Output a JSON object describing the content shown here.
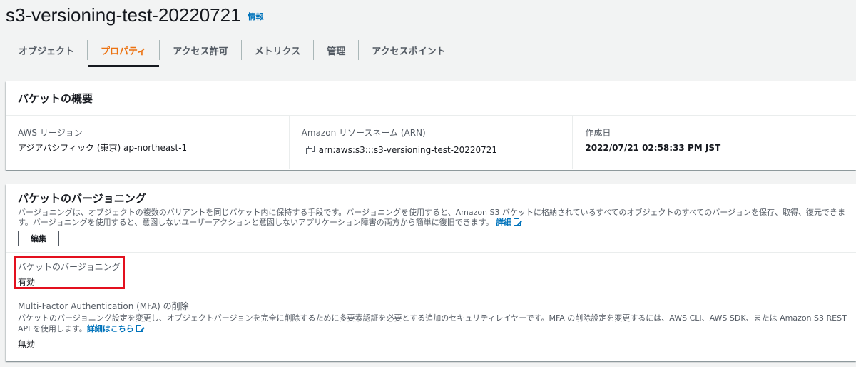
{
  "header": {
    "title": "s3-versioning-test-20220721",
    "info_link": "情報"
  },
  "tabs": [
    {
      "label": "オブジェクト",
      "active": false
    },
    {
      "label": "プロパティ",
      "active": true
    },
    {
      "label": "アクセス許可",
      "active": false
    },
    {
      "label": "メトリクス",
      "active": false
    },
    {
      "label": "管理",
      "active": false
    },
    {
      "label": "アクセスポイント",
      "active": false
    }
  ],
  "overview": {
    "heading": "バケットの概要",
    "region_label": "AWS リージョン",
    "region_value": "アジアパシフィック (東京) ap-northeast-1",
    "arn_label": "Amazon リソースネーム (ARN)",
    "arn_value": "arn:aws:s3:::s3-versioning-test-20220721",
    "created_label": "作成日",
    "created_value": "2022/07/21 02:58:33 PM JST"
  },
  "versioning": {
    "heading": "バケットのバージョニング",
    "description": "バージョニングは、オブジェクトの複数のバリアントを同じバケット内に保持する手段です。バージョニングを使用すると、Amazon S3 バケットに格納されているすべてのオブジェクトのすべてのバージョンを保存、取得、復元できます。バージョニングを使用すると、意図しないユーザーアクションと意図しないアプリケーション障害の両方から簡単に復旧できます。",
    "detail_link": "詳細",
    "edit_button": "編集",
    "status_label": "バケットのバージョニング",
    "status_value": "有効",
    "mfa_label": "Multi-Factor Authentication (MFA) の削除",
    "mfa_description": "バケットのバージョニング設定を変更し、オブジェクトバージョンを完全に削除するために多要素認証を必要とする追加のセキュリティレイヤーです。MFA の削除設定を変更するには、AWS CLI、AWS SDK、または Amazon S3 REST API を使用します。",
    "mfa_detail_link": "詳細はこちら",
    "mfa_value": "無効"
  },
  "colors": {
    "accent": "#ec7211",
    "link": "#0073bb",
    "highlight": "#e3101e"
  },
  "icons": {
    "copy": "copy-icon",
    "external": "external-link-icon"
  }
}
